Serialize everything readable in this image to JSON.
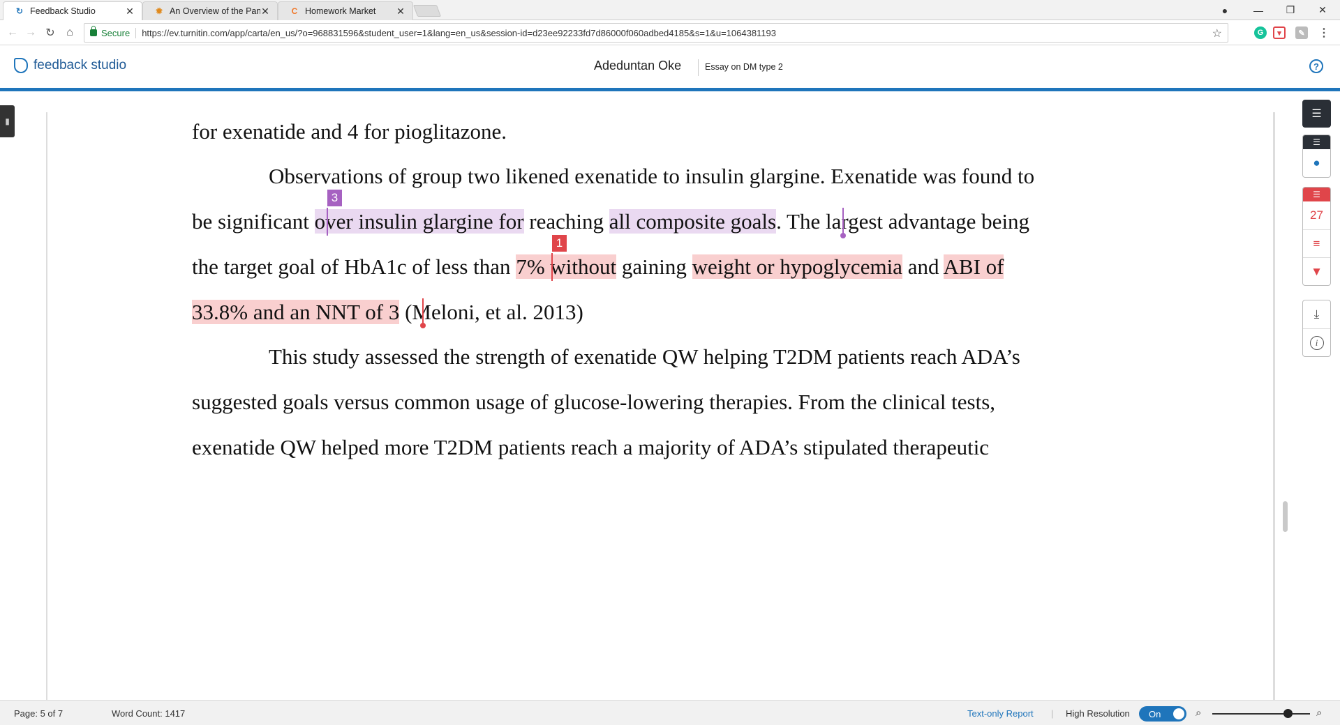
{
  "browser": {
    "tabs": [
      {
        "title": "Feedback Studio",
        "active": true,
        "icon": "turnitin-favicon-icon"
      },
      {
        "title": "An Overview of the Pancr",
        "active": false,
        "icon": "sunburst-favicon-icon"
      },
      {
        "title": "Homework Market",
        "active": false,
        "icon": "c-favicon-icon"
      }
    ],
    "security_label": "Secure",
    "url": "https://ev.turnitin.com/app/carta/en_us/?o=968831596&student_user=1&lang=en_us&session-id=d23ee92233fd7d86000f060adbed4185&s=1&u=1064381193"
  },
  "app": {
    "product_name": "feedback studio",
    "student_name": "Adeduntan Oke",
    "assignment_title": "Essay on DM type 2",
    "help_symbol": "?"
  },
  "document": {
    "line1": "for exenatide and 4 for pioglitazone.",
    "line2": "Observations of group two likened exenatide to insulin glargine. Exenatide was found to",
    "line3": {
      "seg1": "be significant ",
      "seg2_hl": "over insulin glargine for",
      "seg3": " reaching ",
      "seg4_hl": "all composite goals",
      "seg5": ". The largest advantage being"
    },
    "line4": {
      "seg1": "the target goal of HbA1c of less than ",
      "seg2_hl": "7% without",
      "seg3": " gaining ",
      "seg4_hl": "weight or hypoglycemia",
      "seg5": " and ",
      "seg6_hl": "ABI of"
    },
    "line5": {
      "seg1_hl": "33.8% and an NNT of 3",
      "seg2": " (Meloni, et al. 2013)"
    },
    "line6": "This study assessed the strength of exenatide QW helping T2DM patients reach ADA’s",
    "line7": "suggested goals versus common usage of glucose-lowering therapies. From the clinical tests,",
    "line8": "exenatide QW helped more T2DM patients reach a majority of ADA’s stipulated therapeutic",
    "markers": {
      "purple": "3",
      "red": "1"
    },
    "highlight_colors": {
      "purple": "#ead9f1",
      "red": "#f9cfcf"
    }
  },
  "side_panel": {
    "match_count": "27"
  },
  "status_bar": {
    "page": "Page: 5 of 7",
    "word_count": "Word Count: 1417",
    "text_only_report": "Text-only Report",
    "high_resolution": "High Resolution",
    "toggle_state": "On"
  },
  "colors": {
    "brand_blue": "#1f75bb",
    "similarity_red": "#e0454a"
  }
}
